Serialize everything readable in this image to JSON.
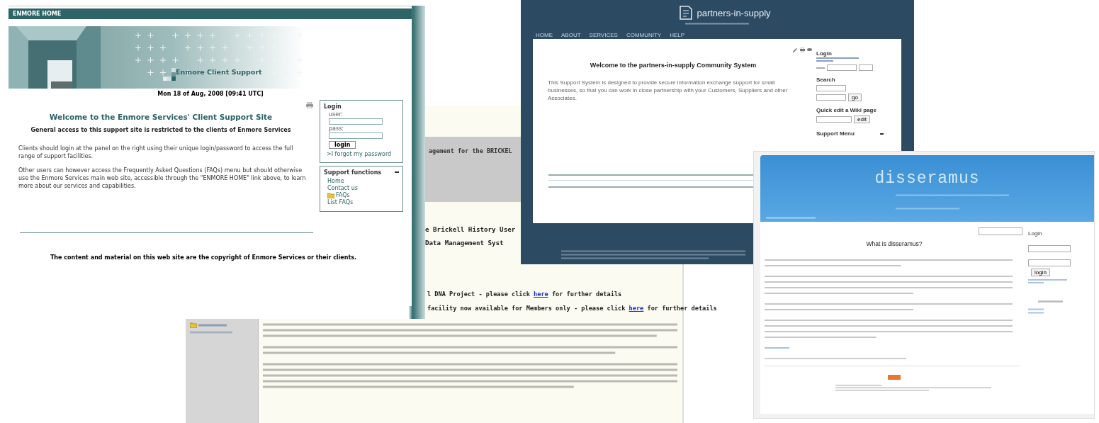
{
  "enmore": {
    "top_link": "ENMORE HOME",
    "banner_title": "Enmore Client Support",
    "date": "Mon 18 of Aug, 2008 [09:41 UTC]",
    "heading": "Welcome to the Enmore Services' Client Support Site",
    "subheading": "General access to this support site is restricted to the clients of Enmore Services",
    "paragraphs": [
      "Clients should login at the panel on the right using their unique login/password to access the full range of support facilities.",
      "Other users can however access the Frequently Asked Questions (FAQs) menu but should otherwise use the Enmore Services main web site, accessible through the \"ENMORE HOME\" link above, to learn more about our services and capabilities."
    ],
    "login": {
      "title": "Login",
      "user_label": "user:",
      "pass_label": "pass:",
      "button": "login",
      "forgot": ">I forgot my password"
    },
    "support": {
      "title": "Support functions",
      "items": [
        {
          "label": "Home",
          "kind": "link"
        },
        {
          "label": "Contact us",
          "kind": "link"
        },
        {
          "label": "FAQs",
          "kind": "folder"
        },
        {
          "label": "List FAQs",
          "kind": "link"
        }
      ]
    },
    "footer": "The content and material on this web site are the copyright of Enmore Services or their clients."
  },
  "brickell": {
    "header": "agement for the BRICKEL",
    "title_lines": [
      "e Brickell History User",
      "Data Management Syst"
    ],
    "notices": [
      {
        "before": "l DNA Project - please click ",
        "link": "here",
        "after": " for further details"
      },
      {
        "before": "facility now available for Members only - please click ",
        "link": "here",
        "after": " for further details"
      }
    ]
  },
  "partners": {
    "logo": "partners-in-supply",
    "nav": [
      "HOME",
      "ABOUT",
      "SERVICES",
      "COMMUNITY",
      "HELP"
    ],
    "heading": "Welcome to the partners-in-supply Community System",
    "paragraph": "This Support System is designed to provide secure information exchange support for small businesses, so that you can work in close partnership with your Customers, Suppliers and other Associates.",
    "sidebar": {
      "login_title": "Login",
      "search_title": "Search",
      "search_button": "go",
      "quick_edit_title": "Quick edit a Wiki page",
      "edit_button": "edit",
      "menu_title": "Support Menu"
    }
  },
  "disseramus": {
    "logo": "disseramus",
    "heading": "What is disseramus?",
    "login_title": "Login",
    "login_button": "login"
  }
}
